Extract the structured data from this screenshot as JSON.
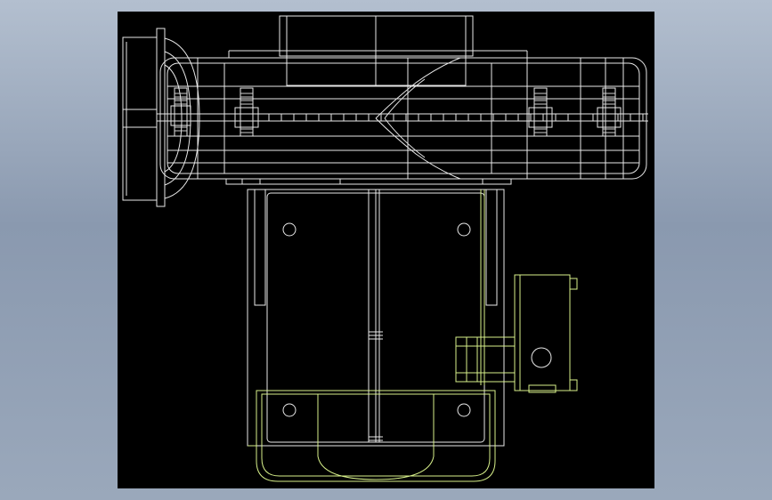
{
  "background": {
    "gradient_top": "#b3bfcf",
    "gradient_bottom": "#8a99af"
  },
  "viewport": {
    "background": "#000000"
  },
  "drawing": {
    "line_colors": {
      "body": "#e8e8e8",
      "motor": "#d7f08a",
      "hidden": "#9a9a9a"
    },
    "subject": "mechanical-assembly-wireframe"
  }
}
